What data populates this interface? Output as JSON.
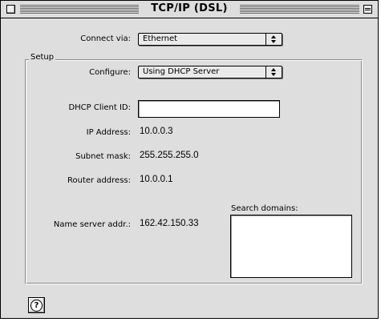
{
  "window": {
    "title": "TCP/IP (DSL)"
  },
  "connect": {
    "label": "Connect via:",
    "value": "Ethernet"
  },
  "setup": {
    "group_label": "Setup",
    "configure_label": "Configure:",
    "configure_value": "Using DHCP Server",
    "dhcp_client_id_label": "DHCP Client ID:",
    "dhcp_client_id_value": "",
    "ip_label": "IP Address:",
    "ip_value": "10.0.0.3",
    "subnet_label": "Subnet mask:",
    "subnet_value": "255.255.255.0",
    "router_label": "Router address:",
    "router_value": "10.0.0.1",
    "name_server_label": "Name server addr.:",
    "name_server_value": "162.42.150.33",
    "search_domains_label": "Search domains:",
    "search_domains_value": ""
  },
  "help": {
    "glyph": "?"
  }
}
